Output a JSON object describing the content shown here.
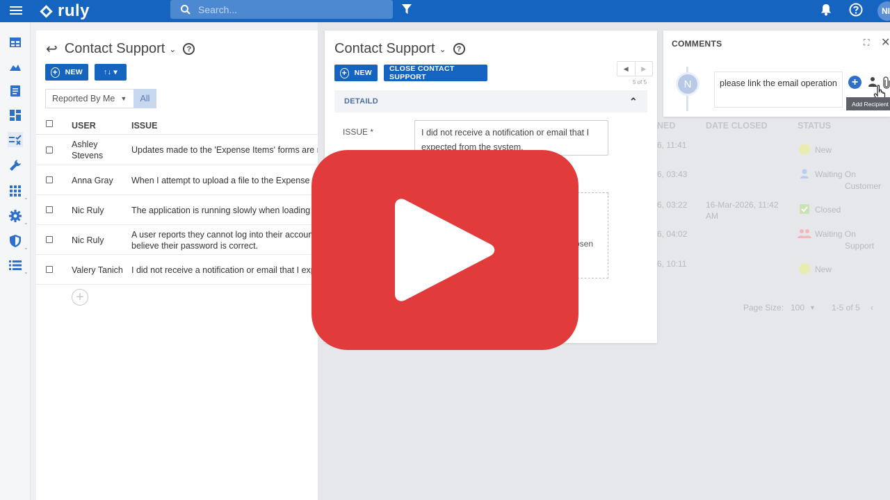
{
  "topbar": {
    "brand": "ruly",
    "search_placeholder": "Search...",
    "avatar_initials": "NI"
  },
  "list_panel": {
    "title": "Contact Support",
    "new_label": "NEW",
    "sort_label": "↑↓ ▾",
    "filter_selected": "Reported By Me",
    "filter_all": "All",
    "columns": {
      "user": "USER",
      "issue": "ISSUE"
    },
    "rows": [
      {
        "user": "Ashley Stevens",
        "issue": "Updates made to the 'Expense Items' forms are not"
      },
      {
        "user": "Anna Gray",
        "issue": "When I attempt to upload a file to the Expense Fo"
      },
      {
        "user": "Nic Ruly",
        "issue": "The application is running slowly when loading p"
      },
      {
        "user": "Nic Ruly",
        "issue": "A user reports they cannot log into their account",
        "issue2": "believe their password is correct."
      },
      {
        "user": "Valery Tanich",
        "issue": "I did not receive a notification or email that I exp"
      }
    ]
  },
  "detail": {
    "title": "Contact Support",
    "new_label": "NEW",
    "close_label": "CLOSE CONTACT SUPPORT",
    "pager_text": "5 of 5",
    "section": "DETAILD",
    "issue_label": "ISSUE *",
    "issue_value": "I did not receive a notification or email that I expected from the system.",
    "drop_text": "osen"
  },
  "comments": {
    "title": "COMMENTS",
    "avatar": "N",
    "draft": "please link the email operation",
    "tooltip": "Add Recipient"
  },
  "right_table": {
    "columns": {
      "opened": "NED",
      "closed": "DATE CLOSED",
      "status": "STATUS"
    },
    "rows": [
      {
        "opened": "6, 11:41",
        "closed": "",
        "status": "New",
        "status_color": "#e9ecb0"
      },
      {
        "opened": "6, 03:43",
        "closed": "",
        "status": "Waiting On",
        "status2": "Customer",
        "status_color": "#b7cdee"
      },
      {
        "opened": "6, 03:22",
        "closed": "16-Mar-2026, 11:42",
        "closed2": "AM",
        "status": "Closed",
        "status_color": "#c9e3b5"
      },
      {
        "opened": "6, 04:02",
        "closed": "",
        "status": "Waiting On",
        "status2": "Support",
        "status_color": "#f0b8b8"
      },
      {
        "opened": "6, 10:11",
        "closed": "",
        "status": "New",
        "status_color": "#e9ecb0"
      }
    ],
    "page_size_label": "Page Size:",
    "page_size_value": "100",
    "range": "1-5 of 5"
  },
  "colors": {
    "primary": "#1565c0",
    "play": "#e13b3b"
  }
}
